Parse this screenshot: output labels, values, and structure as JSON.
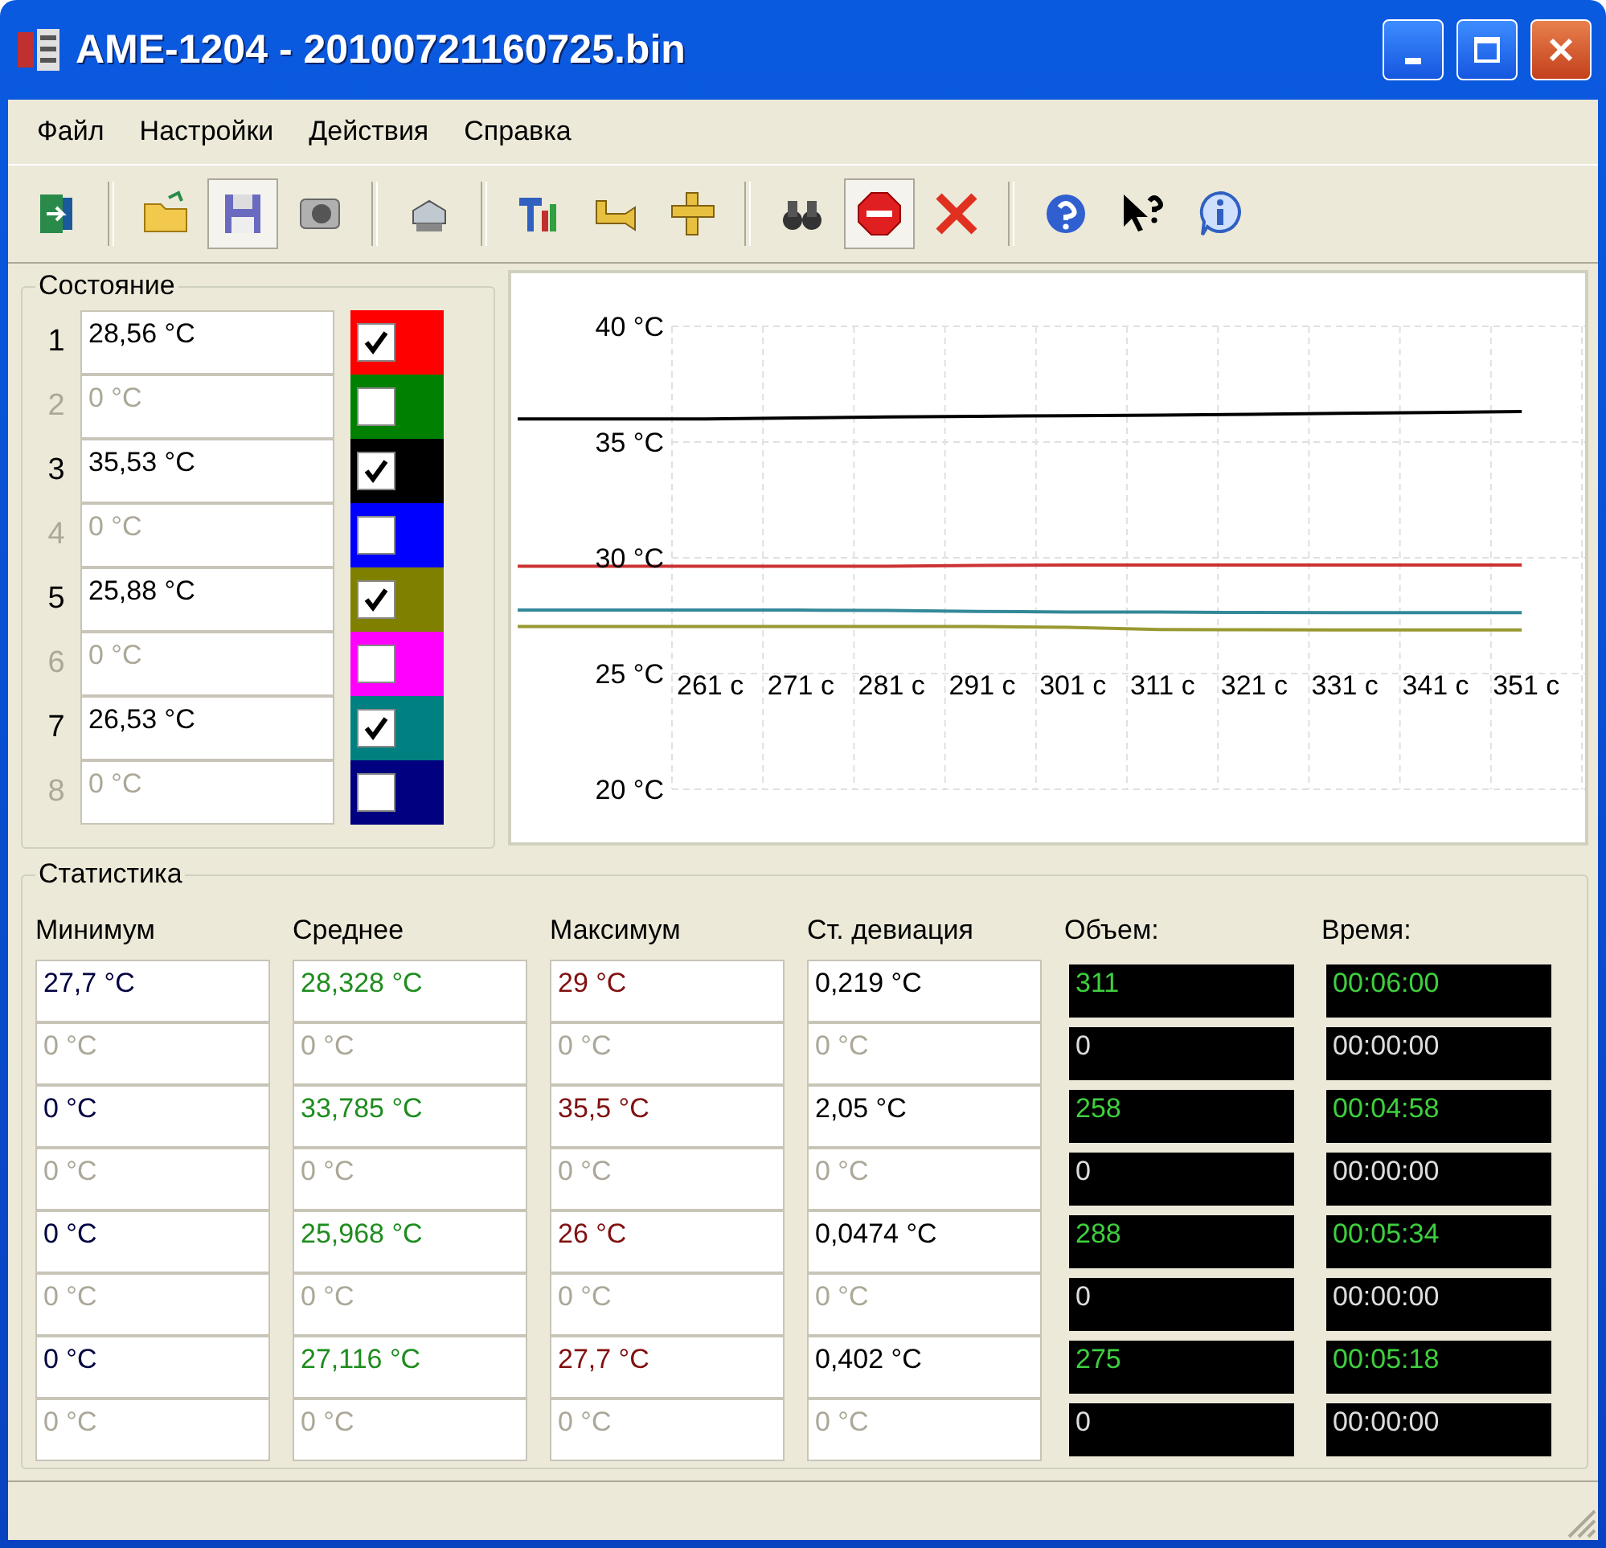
{
  "window": {
    "title": "AME-1204 - 20100721160725.bin"
  },
  "menu": [
    "Файл",
    "Настройки",
    "Действия",
    "Справка"
  ],
  "toolbar": [
    {
      "kind": "exit",
      "pressed": false
    },
    {
      "kind": "separator"
    },
    {
      "kind": "open",
      "pressed": false
    },
    {
      "kind": "save",
      "pressed": true
    },
    {
      "kind": "camera",
      "pressed": false
    },
    {
      "kind": "separator"
    },
    {
      "kind": "print",
      "pressed": false
    },
    {
      "kind": "separator"
    },
    {
      "kind": "tools",
      "pressed": false
    },
    {
      "kind": "pipe",
      "pressed": false
    },
    {
      "kind": "ruler",
      "pressed": false
    },
    {
      "kind": "separator"
    },
    {
      "kind": "find",
      "pressed": false
    },
    {
      "kind": "stop",
      "pressed": true
    },
    {
      "kind": "delete",
      "pressed": false
    },
    {
      "kind": "separator"
    },
    {
      "kind": "help",
      "pressed": false
    },
    {
      "kind": "whatsthis",
      "pressed": false
    },
    {
      "kind": "info",
      "pressed": false
    }
  ],
  "state": {
    "title": "Состояние",
    "channels": [
      {
        "number": "1",
        "value": "28,56 °C",
        "enabled": true,
        "checked": true,
        "color": "#ff0000"
      },
      {
        "number": "2",
        "value": "0 °C",
        "enabled": false,
        "checked": false,
        "color": "#008000"
      },
      {
        "number": "3",
        "value": "35,53 °C",
        "enabled": true,
        "checked": true,
        "color": "#000000"
      },
      {
        "number": "4",
        "value": "0 °C",
        "enabled": false,
        "checked": false,
        "color": "#0000ff"
      },
      {
        "number": "5",
        "value": "25,88 °C",
        "enabled": true,
        "checked": true,
        "color": "#808000"
      },
      {
        "number": "6",
        "value": "0 °C",
        "enabled": false,
        "checked": false,
        "color": "#ff00ff"
      },
      {
        "number": "7",
        "value": "26,53 °C",
        "enabled": true,
        "checked": true,
        "color": "#008080"
      },
      {
        "number": "8",
        "value": "0 °C",
        "enabled": false,
        "checked": false,
        "color": "#000080"
      }
    ]
  },
  "chart_data": {
    "type": "line",
    "grid": true,
    "categories": [
      "261 c",
      "271 c",
      "281 c",
      "291 c",
      "301 c",
      "311 c",
      "321 c",
      "331 c",
      "341 c",
      "351 c"
    ],
    "yticks": [
      {
        "value": 40,
        "label": "40 °C"
      },
      {
        "value": 35,
        "label": "35 °C"
      },
      {
        "value": 30,
        "label": "30 °C"
      },
      {
        "value": 25,
        "label": "25 °C"
      },
      {
        "value": 20,
        "label": "20 °C"
      }
    ],
    "ylim": [
      20,
      40
    ],
    "series": [
      {
        "color": "#000000",
        "values": [
          36.0,
          36.04,
          36.08,
          36.11,
          36.14,
          36.17,
          36.2,
          36.24,
          36.28,
          36.32
        ]
      },
      {
        "color": "#cc3333",
        "values": [
          29.63,
          29.63,
          29.63,
          29.67,
          29.69,
          29.69,
          29.69,
          29.69,
          29.69,
          29.69
        ]
      },
      {
        "color": "#338899",
        "values": [
          27.74,
          27.74,
          27.72,
          27.68,
          27.66,
          27.65,
          27.64,
          27.63,
          27.63,
          27.63
        ]
      },
      {
        "color": "#999933",
        "values": [
          27.03,
          27.03,
          27.03,
          27.03,
          27.0,
          26.9,
          26.89,
          26.88,
          26.88,
          26.88
        ]
      }
    ]
  },
  "stats": {
    "title": "Статистика",
    "columns": [
      "Минимум",
      "Среднее",
      "Максимум",
      "Ст. девиация",
      "Объем:",
      "Время:"
    ],
    "rows": [
      {
        "enabled": true,
        "cells": [
          "27,7 °C",
          "28,328 °C",
          "29 °C",
          "0,219 °C",
          "311",
          "00:06:00"
        ]
      },
      {
        "enabled": false,
        "cells": [
          "0 °C",
          "0 °C",
          "0 °C",
          "0 °C",
          "0",
          "00:00:00"
        ]
      },
      {
        "enabled": true,
        "cells": [
          "0 °C",
          "33,785 °C",
          "35,5 °C",
          "2,05 °C",
          "258",
          "00:04:58"
        ]
      },
      {
        "enabled": false,
        "cells": [
          "0 °C",
          "0 °C",
          "0 °C",
          "0 °C",
          "0",
          "00:00:00"
        ]
      },
      {
        "enabled": true,
        "cells": [
          "0 °C",
          "25,968 °C",
          "26 °C",
          "0,0474 °C",
          "288",
          "00:05:34"
        ]
      },
      {
        "enabled": false,
        "cells": [
          "0 °C",
          "0 °C",
          "0 °C",
          "0 °C",
          "0",
          "00:00:00"
        ]
      },
      {
        "enabled": true,
        "cells": [
          "0 °C",
          "27,116 °C",
          "27,7 °C",
          "0,402 °C",
          "275",
          "00:05:18"
        ]
      },
      {
        "enabled": false,
        "cells": [
          "0 °C",
          "0 °C",
          "0 °C",
          "0 °C",
          "0",
          "00:00:00"
        ]
      }
    ]
  }
}
